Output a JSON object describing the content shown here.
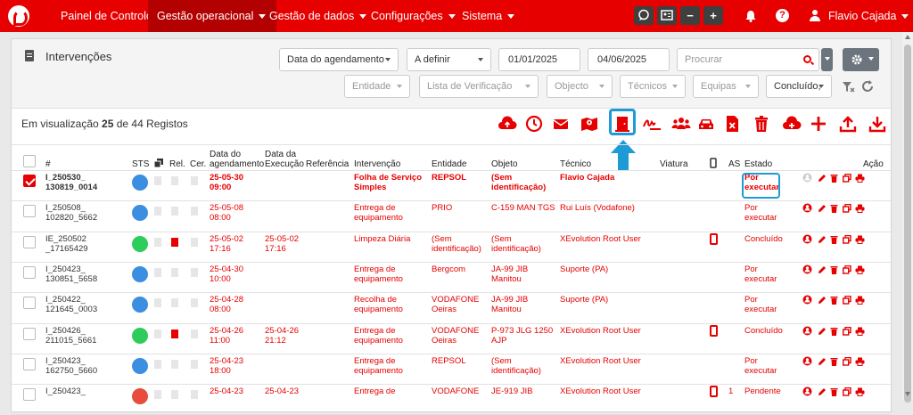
{
  "nav": {
    "items": [
      "Painel de Controlo",
      "Gestão operacional",
      "Gestão de dados",
      "Configurações",
      "Sistema"
    ],
    "buttons": [
      "−",
      "+"
    ],
    "user": "Flavio Cajada",
    "help": "?"
  },
  "header": {
    "title": "Intervenções",
    "filters_row1": [
      "Data do agendamento",
      "A definir",
      "01/01/2025",
      "04/06/2025"
    ],
    "search_placeholder": "Procurar",
    "filters_row2": [
      "Entidade",
      "Lista de Verificação",
      "Objecto",
      "Técnicos",
      "Equipas",
      "Concluído,"
    ]
  },
  "toolbar": {
    "count_prefix": "Em visualização",
    "count_shown": "25",
    "count_suffix": "de 44 Registos",
    "icons": [
      "upload-cloud-icon",
      "clock-icon",
      "email-icon",
      "map-icon",
      "door-icon",
      "signature-icon",
      "team-icon",
      "car-icon",
      "excel-icon",
      "trash-icon",
      "cloud-add-icon",
      "plus-icon",
      "export-icon",
      "download-icon"
    ]
  },
  "table": {
    "headers": {
      "num": "#",
      "sts": "STS",
      "rel": "Rel.",
      "cer": "Cer.",
      "data_agendamento": "Data do agendamento",
      "data_execucao": "Data da Execução",
      "referencia": "Referência",
      "intervencao": "Intervenção",
      "entidade": "Entidade",
      "objeto": "Objeto",
      "tecnico": "Técnico",
      "viatura": "Viatura",
      "as": "AS",
      "estado": "Estado",
      "acao": "Ação"
    },
    "rows": [
      {
        "id1": "I_250530_",
        "id2": "130819_0014",
        "status": "#3b8ee0",
        "ag1": "25-05-30",
        "ag2": "09:00",
        "ex1": "",
        "ex2": "",
        "int1": "Folha de Serviço",
        "int2": "Simples",
        "ent1": "REPSOL",
        "ent2": "",
        "obj1": "(Sem",
        "obj2": "identificação)",
        "tec": "Flavio Cajada",
        "as": "",
        "est1": "Por",
        "est2": "executar",
        "checked": true,
        "bold": true,
        "rel": false,
        "phone": false
      },
      {
        "id1": "I_250508_",
        "id2": "102820_5662",
        "status": "#3b8ee0",
        "ag1": "25-05-08",
        "ag2": "08:00",
        "ex1": "",
        "ex2": "",
        "int1": "Entrega de",
        "int2": "equipamento",
        "ent1": "PRIO",
        "ent2": "",
        "obj1": "C-159 MAN TGS",
        "obj2": "",
        "tec": "Rui Luís (Vodafone)",
        "as": "",
        "est1": "Por",
        "est2": "executar",
        "checked": false,
        "bold": false,
        "rel": false,
        "phone": false
      },
      {
        "id1": "IE_250502",
        "id2": "_17165429",
        "status": "#2ecc5a",
        "ag1": "25-05-02",
        "ag2": "17:16",
        "ex1": "25-05-02",
        "ex2": "17:16",
        "int1": "Limpeza Diária",
        "int2": "",
        "ent1": "(Sem",
        "ent2": "identificação)",
        "obj1": "(Sem",
        "obj2": "identificação)",
        "tec": "XEvolution Root User",
        "as": "",
        "est1": "Concluído",
        "est2": "",
        "checked": false,
        "bold": false,
        "rel": true,
        "phone": true
      },
      {
        "id1": "I_250423_",
        "id2": "130851_5658",
        "status": "#3b8ee0",
        "ag1": "25-04-30",
        "ag2": "10:00",
        "ex1": "",
        "ex2": "",
        "int1": "Entrega de",
        "int2": "equipamento",
        "ent1": "Bergcom",
        "ent2": "",
        "obj1": "JA-99 JIB",
        "obj2": "Manitou",
        "tec": "Suporte (PA)",
        "as": "",
        "est1": "Por",
        "est2": "executar",
        "checked": false,
        "bold": false,
        "rel": false,
        "phone": false
      },
      {
        "id1": "I_250422_",
        "id2": "121645_0003",
        "status": "#3b8ee0",
        "ag1": "25-04-28",
        "ag2": "08:00",
        "ex1": "",
        "ex2": "",
        "int1": "Recolha de",
        "int2": "equipamento",
        "ent1": "VODAFONE",
        "ent2": "Oeiras",
        "obj1": "JA-99 JIB",
        "obj2": "Manitou",
        "tec": "Suporte (PA)",
        "as": "",
        "est1": "Por",
        "est2": "executar",
        "checked": false,
        "bold": false,
        "rel": false,
        "phone": false
      },
      {
        "id1": "I_250426_",
        "id2": "211015_5661",
        "status": "#2ecc5a",
        "ag1": "25-04-26",
        "ag2": "11:00",
        "ex1": "25-04-26",
        "ex2": "21:12",
        "int1": "Entrega de",
        "int2": "equipamento",
        "ent1": "VODAFONE",
        "ent2": "Oeiras",
        "obj1": "P-973 JLG 1250",
        "obj2": "AJP",
        "tec": "XEvolution Root User",
        "as": "",
        "est1": "Concluído",
        "est2": "",
        "checked": false,
        "bold": false,
        "rel": true,
        "phone": true
      },
      {
        "id1": "I_250423_",
        "id2": "162750_5660",
        "status": "#3b8ee0",
        "ag1": "25-04-23",
        "ag2": "18:00",
        "ex1": "",
        "ex2": "",
        "int1": "Entrega de",
        "int2": "equipamento",
        "ent1": "REPSOL",
        "ent2": "",
        "obj1": "(Sem",
        "obj2": "identificação)",
        "tec": "XEvolution Root User",
        "as": "",
        "est1": "Por",
        "est2": "executar",
        "checked": false,
        "bold": false,
        "rel": false,
        "phone": false
      },
      {
        "id1": "I_250423_",
        "id2": "",
        "status": "#e74c3c",
        "ag1": "25-04-23",
        "ag2": "",
        "ex1": "25-04-23",
        "ex2": "",
        "int1": "Entrega de",
        "int2": "",
        "ent1": "VODAFONE",
        "ent2": "",
        "obj1": "JE-919 JIB",
        "obj2": "",
        "tec": "XEvolution Root User",
        "as": "1",
        "est1": "Pendente",
        "est2": "",
        "checked": false,
        "bold": false,
        "rel": false,
        "phone": true
      }
    ]
  }
}
